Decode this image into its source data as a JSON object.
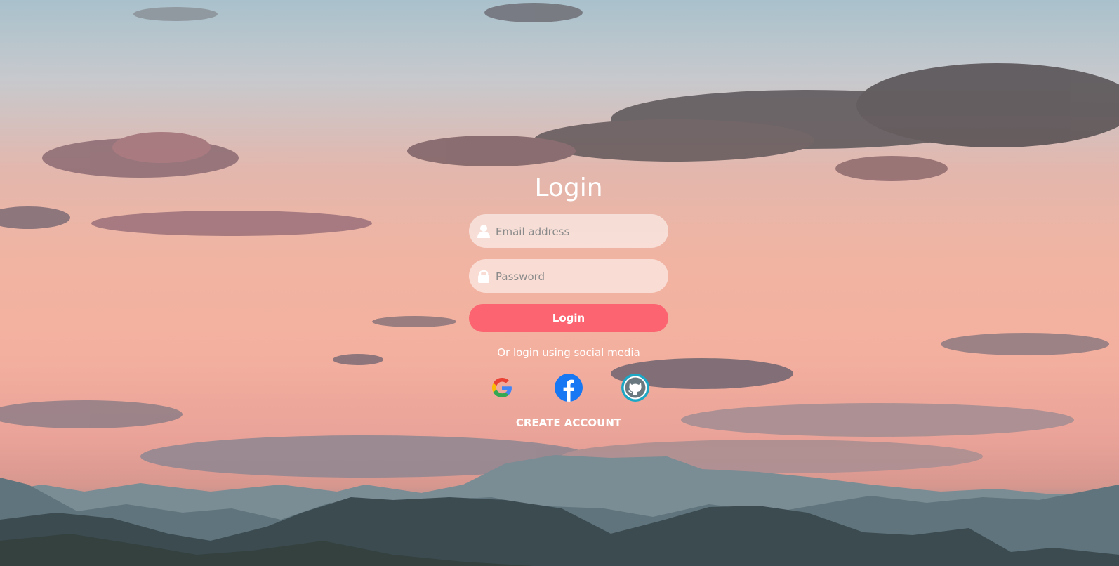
{
  "login": {
    "title": "Login",
    "email_placeholder": "Email address",
    "password_placeholder": "Password",
    "login_button": "Login",
    "social_text": "Or login using social media",
    "create_account": "CREATE ACCOUNT"
  },
  "social": [
    {
      "name": "google",
      "icon": "google-icon"
    },
    {
      "name": "facebook",
      "icon": "facebook-icon"
    },
    {
      "name": "github",
      "icon": "github-icon"
    }
  ],
  "colors": {
    "accent": "#fb6470",
    "facebook": "#1877f2",
    "github_ring": "#1ea7c4"
  }
}
